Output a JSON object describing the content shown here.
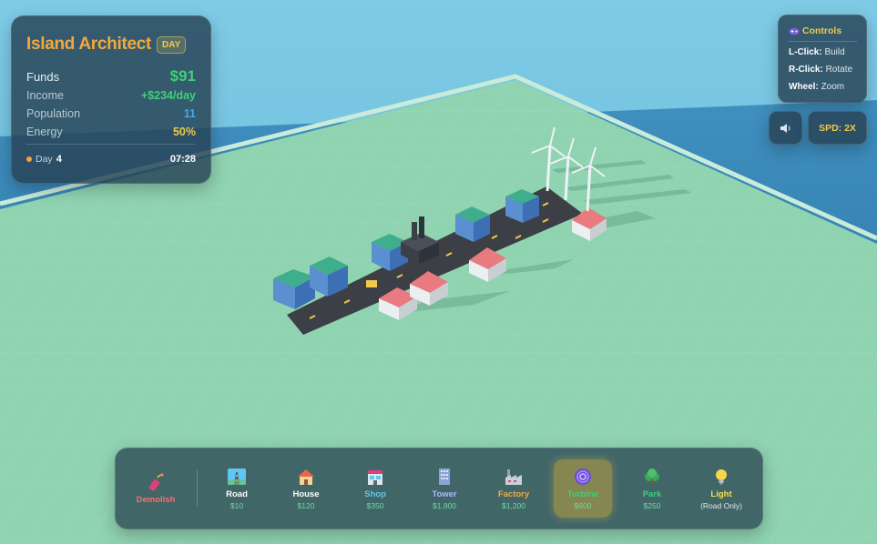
{
  "colors": {
    "sky": "#6fc2df",
    "sea": "#2e7fb0",
    "ground": "#8ed1b0",
    "road": "#3c3f45",
    "funds": "#3ed07b",
    "energy": "#f2c94c",
    "title": "#f4a83a"
  },
  "stats": {
    "title": "Island Architect",
    "phase_badge": "DAY",
    "funds_label": "Funds",
    "funds_value": "$91",
    "income_label": "Income",
    "income_value": "+$234/day",
    "population_label": "Population",
    "population_value": "11",
    "energy_label": "Energy",
    "energy_value": "50%",
    "day_label": "Day",
    "day_value": "4",
    "clock": "07:28"
  },
  "controls": {
    "icon": "gamepad-icon",
    "title": "Controls",
    "items": [
      {
        "key": "L-Click:",
        "action": "Build"
      },
      {
        "key": "R-Click:",
        "action": "Rotate"
      },
      {
        "key": "Wheel:",
        "action": "Zoom"
      }
    ]
  },
  "buttons": {
    "sound_icon": "speaker-icon",
    "speed": "SPD: 2X"
  },
  "toolbar": {
    "selected": "Turbine",
    "tools": [
      {
        "name": "Demolish",
        "price": "",
        "icon": "dynamite-icon",
        "color": "#ff6b6b"
      },
      {
        "name": "Road",
        "price": "$10",
        "icon": "road-icon",
        "color": "#ffffff"
      },
      {
        "name": "House",
        "price": "$120",
        "icon": "house-icon",
        "color": "#ffffff"
      },
      {
        "name": "Shop",
        "price": "$350",
        "icon": "shop-icon",
        "color": "#5ec8f2"
      },
      {
        "name": "Tower",
        "price": "$1,800",
        "icon": "office-tower-icon",
        "color": "#a9b8ff"
      },
      {
        "name": "Factory",
        "price": "$1,200",
        "icon": "factory-icon",
        "color": "#f4a83a"
      },
      {
        "name": "Turbine",
        "price": "$600",
        "icon": "wind-turbine-icon",
        "color": "#3ed07b"
      },
      {
        "name": "Park",
        "price": "$250",
        "icon": "tree-icon",
        "color": "#3ed07b"
      },
      {
        "name": "Light",
        "price": "(Road Only)",
        "icon": "light-bulb-icon",
        "color": "#f2e04c"
      }
    ]
  }
}
